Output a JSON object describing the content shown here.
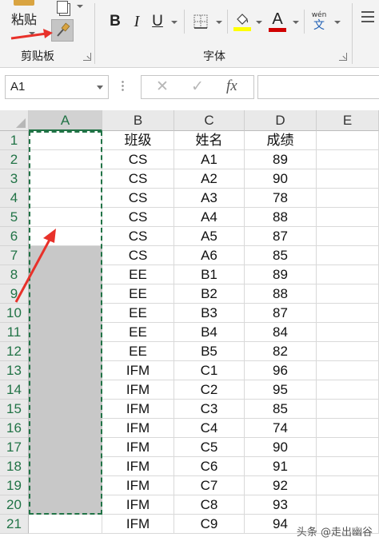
{
  "ribbon": {
    "clipboard": {
      "paste_label": "粘贴",
      "group_label": "剪贴板"
    },
    "font": {
      "group_label": "字体",
      "bold": "B",
      "italic": "I",
      "underline": "U",
      "font_color_letter": "A",
      "phonetic_top": "wén",
      "phonetic_bottom": "文",
      "fill_color": "#ffff00",
      "font_color": "#d00000"
    }
  },
  "formula_bar": {
    "name_box": "A1",
    "cancel": "✕",
    "enter": "✓",
    "fx": "fx",
    "content": ""
  },
  "columns": [
    "A",
    "B",
    "C",
    "D",
    "E"
  ],
  "selected_column": "A",
  "rows": [
    {
      "n": "1",
      "b": "班级",
      "c": "姓名",
      "d": "成绩"
    },
    {
      "n": "2",
      "b": "CS",
      "c": "A1",
      "d": "89"
    },
    {
      "n": "3",
      "b": "CS",
      "c": "A2",
      "d": "90"
    },
    {
      "n": "4",
      "b": "CS",
      "c": "A3",
      "d": "78"
    },
    {
      "n": "5",
      "b": "CS",
      "c": "A4",
      "d": "88"
    },
    {
      "n": "6",
      "b": "CS",
      "c": "A5",
      "d": "87"
    },
    {
      "n": "7",
      "b": "CS",
      "c": "A6",
      "d": "85"
    },
    {
      "n": "8",
      "b": "EE",
      "c": "B1",
      "d": "89"
    },
    {
      "n": "9",
      "b": "EE",
      "c": "B2",
      "d": "88"
    },
    {
      "n": "10",
      "b": "EE",
      "c": "B3",
      "d": "87"
    },
    {
      "n": "11",
      "b": "EE",
      "c": "B4",
      "d": "84"
    },
    {
      "n": "12",
      "b": "EE",
      "c": "B5",
      "d": "82"
    },
    {
      "n": "13",
      "b": "IFM",
      "c": "C1",
      "d": "96"
    },
    {
      "n": "14",
      "b": "IFM",
      "c": "C2",
      "d": "95"
    },
    {
      "n": "15",
      "b": "IFM",
      "c": "C3",
      "d": "85"
    },
    {
      "n": "16",
      "b": "IFM",
      "c": "C4",
      "d": "74"
    },
    {
      "n": "17",
      "b": "IFM",
      "c": "C5",
      "d": "90"
    },
    {
      "n": "18",
      "b": "IFM",
      "c": "C6",
      "d": "91"
    },
    {
      "n": "19",
      "b": "IFM",
      "c": "C7",
      "d": "92"
    },
    {
      "n": "20",
      "b": "IFM",
      "c": "C8",
      "d": "93"
    },
    {
      "n": "21",
      "b": "IFM",
      "c": "C9",
      "d": "94"
    }
  ],
  "gray_rows_start": 7,
  "gray_rows_end": 20,
  "annotation_color": "#e8312a",
  "watermark": "头条 @走出幽谷"
}
